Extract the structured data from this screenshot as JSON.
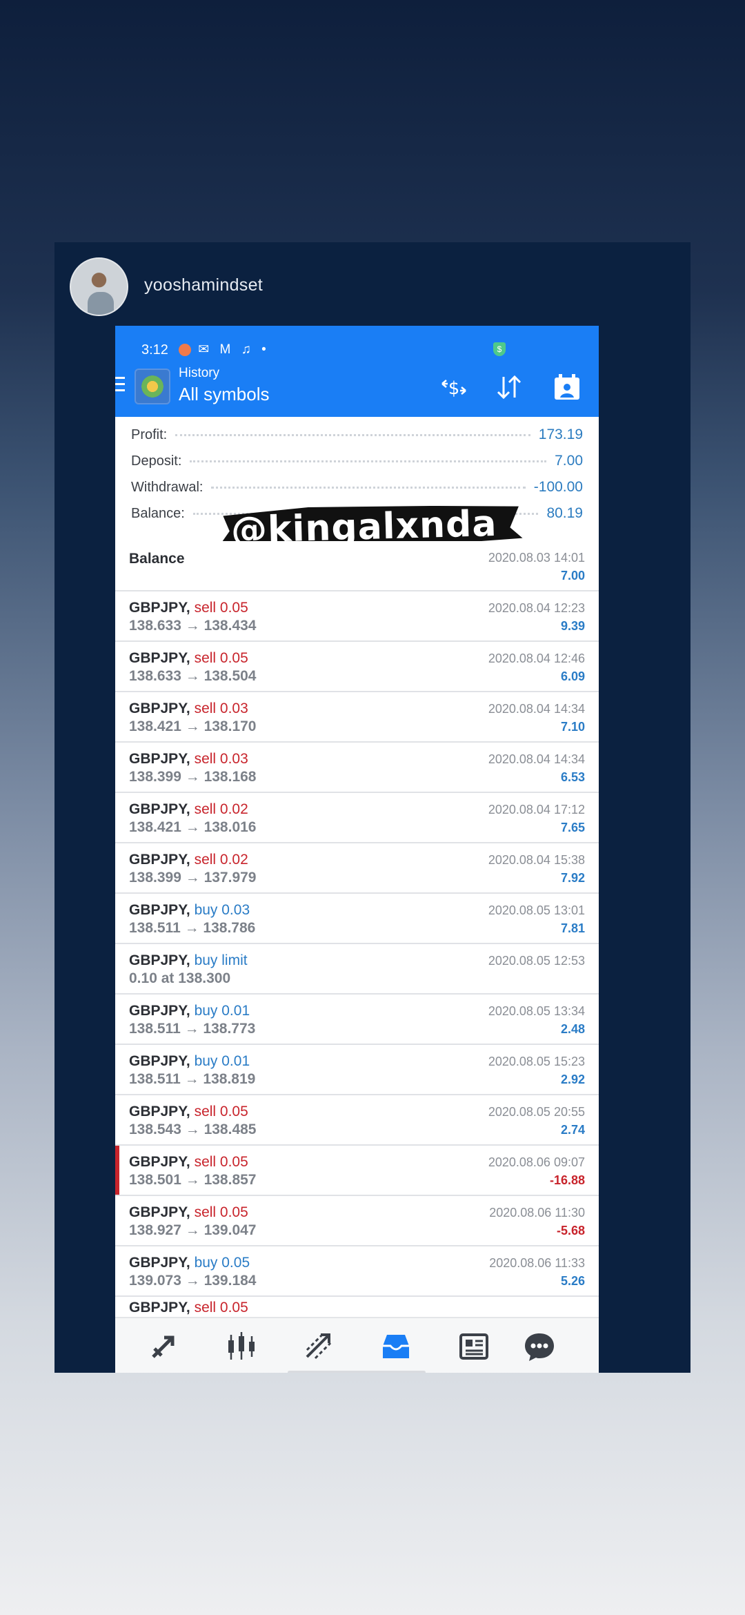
{
  "story": {
    "username": "yooshamindset"
  },
  "status_bar": {
    "time": "3:12",
    "icons": "✉ M ♫ •"
  },
  "toolbar": {
    "subtitle": "History",
    "title": "All symbols"
  },
  "summary": {
    "profit_label": "Profit:",
    "profit": "173.19",
    "deposit_label": "Deposit:",
    "deposit": "7.00",
    "withdrawal_label": "Withdrawal:",
    "withdrawal": "-100.00",
    "balance_label": "Balance:",
    "balance": "80.19"
  },
  "watermark": "@kingalxnda",
  "balance_row": {
    "label": "Balance",
    "time": "2020.08.03 14:01",
    "amount": "7.00"
  },
  "deals": [
    {
      "symbol": "GBPJPY,",
      "side": "sell 0.05",
      "prices": "138.633 → 138.434",
      "time": "2020.08.04 12:23",
      "profit": "9.39"
    },
    {
      "symbol": "GBPJPY,",
      "side": "sell 0.05",
      "prices": "138.633 → 138.504",
      "time": "2020.08.04 12:46",
      "profit": "6.09"
    },
    {
      "symbol": "GBPJPY,",
      "side": "sell 0.03",
      "prices": "138.421 → 138.170",
      "time": "2020.08.04 14:34",
      "profit": "7.10"
    },
    {
      "symbol": "GBPJPY,",
      "side": "sell 0.03",
      "prices": "138.399 → 138.168",
      "time": "2020.08.04 14:34",
      "profit": "6.53"
    },
    {
      "symbol": "GBPJPY,",
      "side": "sell 0.02",
      "prices": "138.421 → 138.016",
      "time": "2020.08.04 17:12",
      "profit": "7.65"
    },
    {
      "symbol": "GBPJPY,",
      "side": "sell 0.02",
      "prices": "138.399 → 137.979",
      "time": "2020.08.04 15:38",
      "profit": "7.92"
    },
    {
      "symbol": "GBPJPY,",
      "side": "buy 0.03",
      "prices": "138.511 → 138.786",
      "time": "2020.08.05 13:01",
      "profit": "7.81"
    },
    {
      "symbol": "GBPJPY,",
      "side": "buy limit",
      "prices": "0.10 at 138.300",
      "time": "2020.08.05 12:53",
      "profit": ""
    },
    {
      "symbol": "GBPJPY,",
      "side": "buy 0.01",
      "prices": "138.511 → 138.773",
      "time": "2020.08.05 13:34",
      "profit": "2.48"
    },
    {
      "symbol": "GBPJPY,",
      "side": "buy 0.01",
      "prices": "138.511 → 138.819",
      "time": "2020.08.05 15:23",
      "profit": "2.92"
    },
    {
      "symbol": "GBPJPY,",
      "side": "sell 0.05",
      "prices": "138.543 → 138.485",
      "time": "2020.08.05 20:55",
      "profit": "2.74"
    },
    {
      "symbol": "GBPJPY,",
      "side": "sell 0.05",
      "prices": "138.501 → 138.857",
      "time": "2020.08.06 09:07",
      "profit": "-16.88"
    },
    {
      "symbol": "GBPJPY,",
      "side": "sell 0.05",
      "prices": "138.927 → 139.047",
      "time": "2020.08.06 11:30",
      "profit": "-5.68"
    },
    {
      "symbol": "GBPJPY,",
      "side": "buy 0.05",
      "prices": "139.073 → 139.184",
      "time": "2020.08.06 11:33",
      "profit": "5.26"
    }
  ],
  "partial_row": {
    "symbol": "GBPJPY,",
    "side": "sell 0.05"
  },
  "colors": {
    "accent": "#1a7ef5",
    "sell": "#c8242c",
    "buy": "#2a7cc6",
    "nav_active": "#1a7ef5",
    "nav_inactive": "#3b4048"
  },
  "nav_icons": [
    "quotes-icon",
    "chart-icon",
    "trade-icon",
    "history-icon",
    "news-icon",
    "chat-icon"
  ]
}
